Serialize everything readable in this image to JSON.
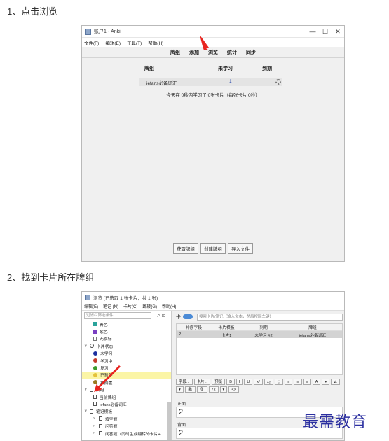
{
  "step1": "1、点击浏览",
  "step2": "2、找到卡片所在牌组",
  "main_window": {
    "title": "账户1 - Anki",
    "menu": [
      "文件(F)",
      "编辑(E)",
      "工具(T)",
      "帮助(H)"
    ],
    "toplinks": [
      "牌组",
      "添加",
      "浏览",
      "统计",
      "同步"
    ],
    "deck_headers": {
      "deck": "牌组",
      "new": "未学习",
      "due": "到期"
    },
    "deck_row": {
      "name": "iefans必备词汇",
      "new": "1",
      "due": ""
    },
    "studied_text": "今天在 0秒内学习了 0张卡片（每张卡片 0秒）",
    "bottom_buttons": [
      "获取牌组",
      "创建牌组",
      "导入文件"
    ]
  },
  "browse_window": {
    "title": "浏览 (已选取 1 张卡片，共 1 张)",
    "menu": [
      "编辑(E)",
      "笔记 (N)",
      "卡片(C)",
      "跳转(G)",
      "帮助(H)"
    ],
    "sidebar_filter_placeholder": "过滤栏筛选条件",
    "search_placeholder": "搜索卡片/笔记（输入文本，然后按回车键）",
    "sidebar_items": [
      {
        "label": "青色",
        "kind": "flag",
        "color": "#2aa39b",
        "indent": 1
      },
      {
        "label": "紫色",
        "kind": "flag",
        "color": "#7a3fc2",
        "indent": 1
      },
      {
        "label": "无旗标",
        "kind": "flag-empty",
        "color": "#777777",
        "indent": 1
      },
      {
        "label": "卡片状态",
        "kind": "group-circle",
        "indent": 0
      },
      {
        "label": "未学习",
        "kind": "dot",
        "color": "#1c2f9e",
        "indent": 1
      },
      {
        "label": "学习中",
        "kind": "dot",
        "color": "#c33a2b",
        "indent": 1
      },
      {
        "label": "复习",
        "kind": "dot",
        "color": "#3a9b2d",
        "indent": 1
      },
      {
        "label": "已暂停",
        "kind": "dot",
        "color": "#e3c23a",
        "indent": 1,
        "selected": true
      },
      {
        "label": "被搁置",
        "kind": "dot",
        "color": "#9a7b22",
        "indent": 1
      },
      {
        "label": "牌组",
        "kind": "group-square",
        "indent": 0
      },
      {
        "label": "当前牌组",
        "kind": "square",
        "indent": 1
      },
      {
        "label": "iefans必备词汇",
        "kind": "square",
        "indent": 1
      },
      {
        "label": "笔记模板",
        "kind": "group-square",
        "indent": 0
      },
      {
        "label": "填空题",
        "kind": "square-expand",
        "indent": 1
      },
      {
        "label": "问答题",
        "kind": "square-expand",
        "indent": 1
      },
      {
        "label": "问答题（同时生成翻转的卡片+...",
        "kind": "square-expand",
        "indent": 1
      }
    ],
    "table": {
      "headers": [
        "排序字段",
        "卡片模板",
        "到期",
        "牌组"
      ],
      "rows": [
        [
          "2",
          "卡片1",
          "未学习 #2",
          "iefans必备词汇"
        ]
      ]
    },
    "editor_buttons": [
      "字段...",
      "卡片...",
      "预览",
      "B",
      "I",
      "U",
      "x²",
      "x₂",
      "◇",
      "≡",
      "≡",
      "≡",
      "A",
      "▾",
      "∠",
      "▾",
      "🖇",
      "🎙",
      "ƒx",
      "▾",
      "<>"
    ],
    "fields": [
      {
        "label": "正面",
        "value": "2"
      },
      {
        "label": "背面",
        "value": "2"
      }
    ]
  },
  "watermark": "最需教育",
  "colors": {
    "arrow": "#e8241f",
    "watermark": "#2b2fa0",
    "selected_row": "#fbf5a6"
  }
}
